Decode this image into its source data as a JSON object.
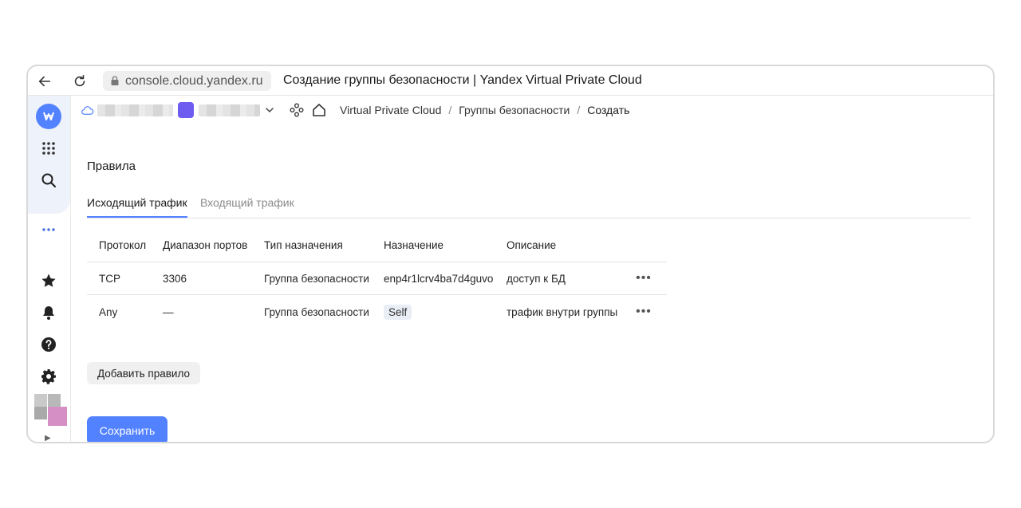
{
  "browser": {
    "url": "console.cloud.yandex.ru",
    "tab_title": "Создание группы безопасности | Yandex Virtual Private Cloud"
  },
  "breadcrumbs": {
    "items": [
      "Virtual Private Cloud",
      "Группы безопасности",
      "Создать"
    ],
    "separator": "/"
  },
  "main": {
    "section_title": "Правила",
    "tabs": [
      {
        "label": "Исходящий трафик",
        "active": true
      },
      {
        "label": "Входящий трафик",
        "active": false
      }
    ],
    "table": {
      "columns": [
        "Протокол",
        "Диапазон портов",
        "Тип назначения",
        "Назначение",
        "Описание"
      ],
      "rows": [
        {
          "protocol": "TCP",
          "ports": "3306",
          "dest_type": "Группа безопасности",
          "destination": "enp4r1lcrv4ba7d4guvo",
          "description": "доступ к БД"
        },
        {
          "protocol": "Any",
          "ports": "—",
          "dest_type": "Группа безопасности",
          "destination": "Self",
          "description": "трафик внутри группы"
        }
      ]
    },
    "add_rule_label": "Добавить правило",
    "save_label": "Сохранить"
  },
  "colors": {
    "accent": "#5282ff",
    "folder": "#6e5bf0",
    "sidebar_bg": "#eef2fa"
  }
}
